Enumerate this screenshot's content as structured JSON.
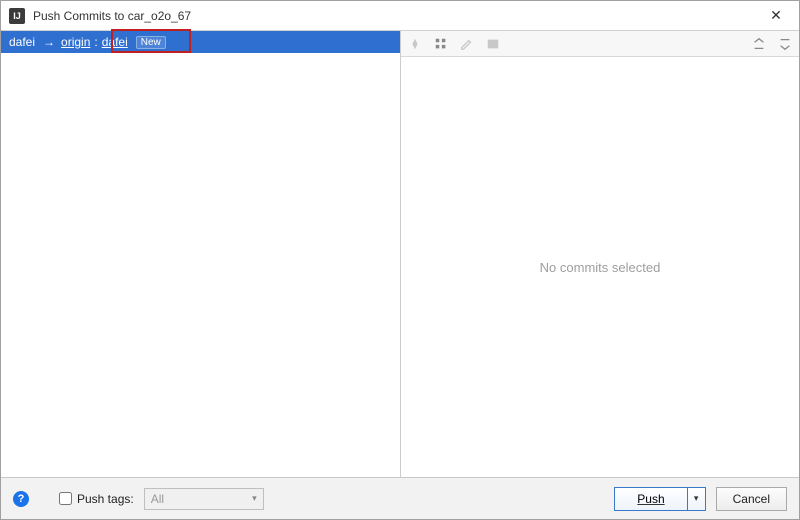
{
  "titlebar": {
    "title": "Push Commits to car_o2o_67"
  },
  "branch": {
    "local": "dafei",
    "remote": "origin",
    "target": "dafei",
    "badge": "New"
  },
  "rightPanel": {
    "empty_text": "No commits selected"
  },
  "footer": {
    "push_tags_label": "Push tags:",
    "select_value": "All",
    "push_label": "Push",
    "cancel_label": "Cancel"
  }
}
